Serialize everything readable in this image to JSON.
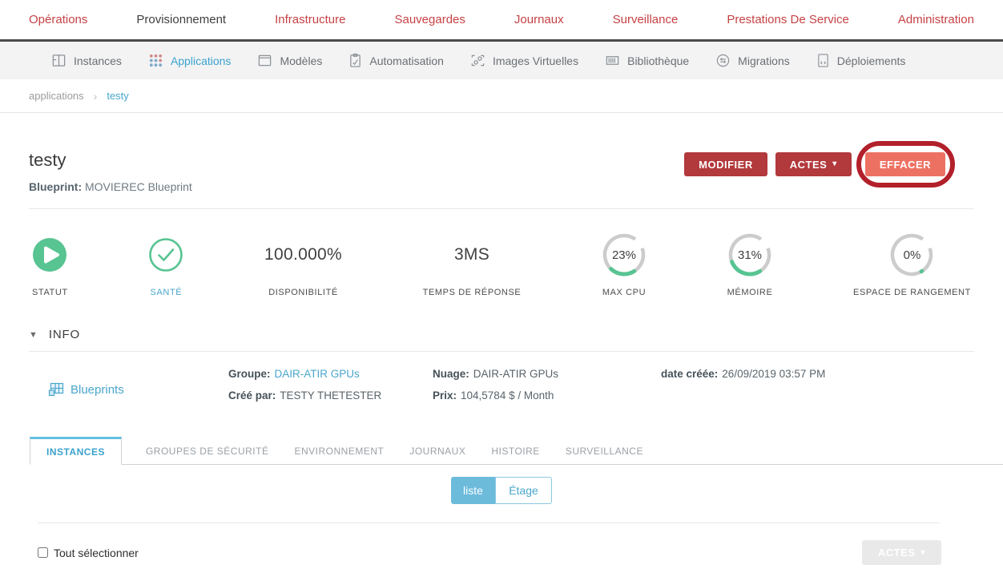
{
  "topnav": {
    "items": [
      "Opérations",
      "Provisionnement",
      "Infrastructure",
      "Sauvegardes",
      "Journaux",
      "Surveillance",
      "Prestations De Service",
      "Administration"
    ]
  },
  "subnav": {
    "items": [
      {
        "label": "Instances"
      },
      {
        "label": "Applications"
      },
      {
        "label": "Modèles"
      },
      {
        "label": "Automatisation"
      },
      {
        "label": "Images Virtuelles"
      },
      {
        "label": "Bibliothèque"
      },
      {
        "label": "Migrations"
      },
      {
        "label": "Déploiements"
      }
    ]
  },
  "breadcrumb": {
    "parent": "applications",
    "current": "testy"
  },
  "header": {
    "title": "testy",
    "blueprint_label": "Blueprint:",
    "blueprint_value": "MOVIEREC Blueprint",
    "modify": "MODIFIER",
    "actions": "ACTES",
    "delete": "EFFACER"
  },
  "metrics": {
    "items": [
      {
        "label": "STATUT",
        "type": "status-running"
      },
      {
        "label": "SANTÉ",
        "type": "health-ok"
      },
      {
        "label": "DISPONIBILITÉ",
        "value": "100.000%"
      },
      {
        "label": "TEMPS DE RÉPONSE",
        "value": "3MS"
      },
      {
        "label": "MAX CPU",
        "value": "23%",
        "gauge": 23
      },
      {
        "label": "MÉMOIRE",
        "value": "31%",
        "gauge": 31
      },
      {
        "label": "ESPACE DE RANGEMENT",
        "value": "0%",
        "gauge": 0
      }
    ]
  },
  "info": {
    "header": "INFO",
    "blueprints_link": "Blueprints",
    "group_label": "Groupe:",
    "group_value": "DAIR-ATIR GPUs",
    "created_by_label": "Créé par:",
    "created_by_value": "TESTY THETESTER",
    "cloud_label": "Nuage:",
    "cloud_value": "DAIR-ATIR GPUs",
    "price_label": "Prix:",
    "price_value": "104,5784 $ / Month",
    "date_label": "date créée:",
    "date_value": "26/09/2019 03:57 PM"
  },
  "tabs": {
    "items": [
      "INSTANCES",
      "GROUPES DE SÉCURITÉ",
      "ENVIRONNEMENT",
      "JOURNAUX",
      "HISTOIRE",
      "SURVEILLANCE"
    ]
  },
  "view_toggle": {
    "list": "liste",
    "stage": "Étage"
  },
  "footer": {
    "select_all": "Tout sélectionner",
    "actions": "ACTES"
  },
  "colors": {
    "nav_red": "#c64245",
    "accent_blue": "#4aa6cb",
    "green": "#57c492",
    "button_dark_red": "#b2393c",
    "button_delete": "#ed7163",
    "annotation_ring": "#b2202a",
    "gauge_track": "#cccccc",
    "toggle_active": "#6cbbdb"
  }
}
